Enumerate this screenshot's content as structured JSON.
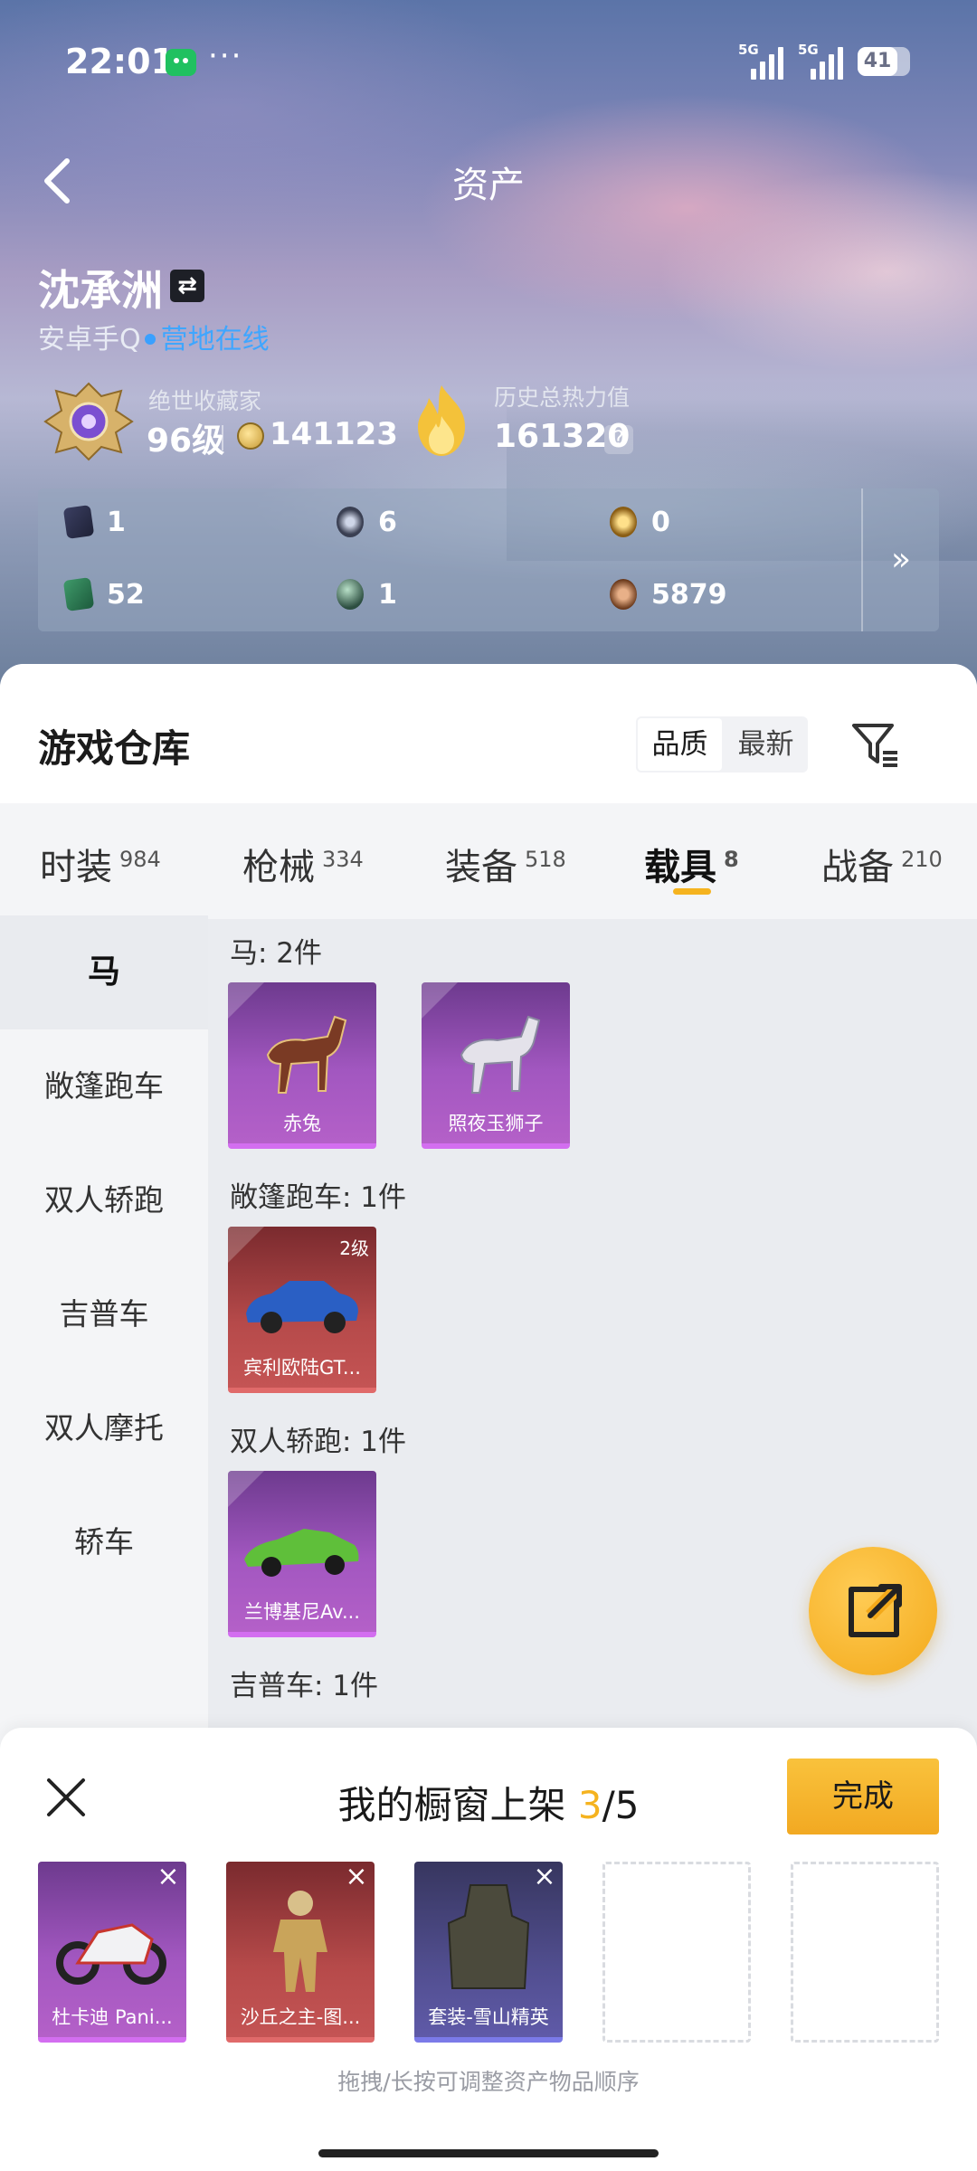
{
  "status_bar": {
    "time": "22:01",
    "more": "···",
    "signal1": "5G",
    "signal2": "5G",
    "battery": "41"
  },
  "header": {
    "title": "资产"
  },
  "profile": {
    "name": "沈承洲",
    "platform": "安卓手Q",
    "online_status": "营地在线",
    "rank_title": "绝世收藏家",
    "rank_level": "96级",
    "coins": "141123",
    "heat_title": "历史总热力值",
    "heat_value": "161320",
    "heat_help": "?"
  },
  "stats": [
    {
      "icon": "card-icon",
      "value": "1"
    },
    {
      "icon": "token-icon",
      "value": "6"
    },
    {
      "icon": "gold-coin-icon",
      "value": "0"
    },
    {
      "icon": "green-card-icon",
      "value": "52"
    },
    {
      "icon": "orb-icon",
      "value": "1"
    },
    {
      "icon": "bronze-coin-icon",
      "value": "5879"
    }
  ],
  "stats_more": "»",
  "warehouse": {
    "title": "游戏仓库",
    "sort_options": [
      "品质",
      "最新"
    ],
    "tabs": [
      {
        "label": "时装",
        "count": "984"
      },
      {
        "label": "枪械",
        "count": "334"
      },
      {
        "label": "装备",
        "count": "518"
      },
      {
        "label": "载具",
        "count": "8"
      },
      {
        "label": "战备",
        "count": "210"
      }
    ],
    "categories": [
      "马",
      "敞篷跑车",
      "双人轿跑",
      "吉普车",
      "双人摩托",
      "轿车"
    ],
    "sections": [
      {
        "title": "马: 2件",
        "items": [
          {
            "name": "赤兔"
          },
          {
            "name": "照夜玉狮子"
          }
        ]
      },
      {
        "title": "敞篷跑车: 1件",
        "items": [
          {
            "name": "宾利欧陆GT...",
            "level": "2级"
          }
        ]
      },
      {
        "title": "双人轿跑: 1件",
        "items": [
          {
            "name": "兰博基尼Av..."
          }
        ]
      },
      {
        "title": "吉普车: 1件",
        "items": []
      }
    ]
  },
  "showcase": {
    "title": "我的橱窗上架",
    "filled": "3",
    "total": "/5",
    "done": "完成",
    "slots": [
      {
        "name": "杜卡迪 Pani..."
      },
      {
        "name": "沙丘之主-图..."
      },
      {
        "name": "套装-雪山精英"
      }
    ],
    "close": "×",
    "hint": "拖拽/长按可调整资产物品顺序"
  },
  "colors": {
    "accent": "#f5b31f",
    "online": "#3fa6ff",
    "purple": "#a257c0",
    "red": "#b64a4a",
    "blue": "#514e8f"
  }
}
